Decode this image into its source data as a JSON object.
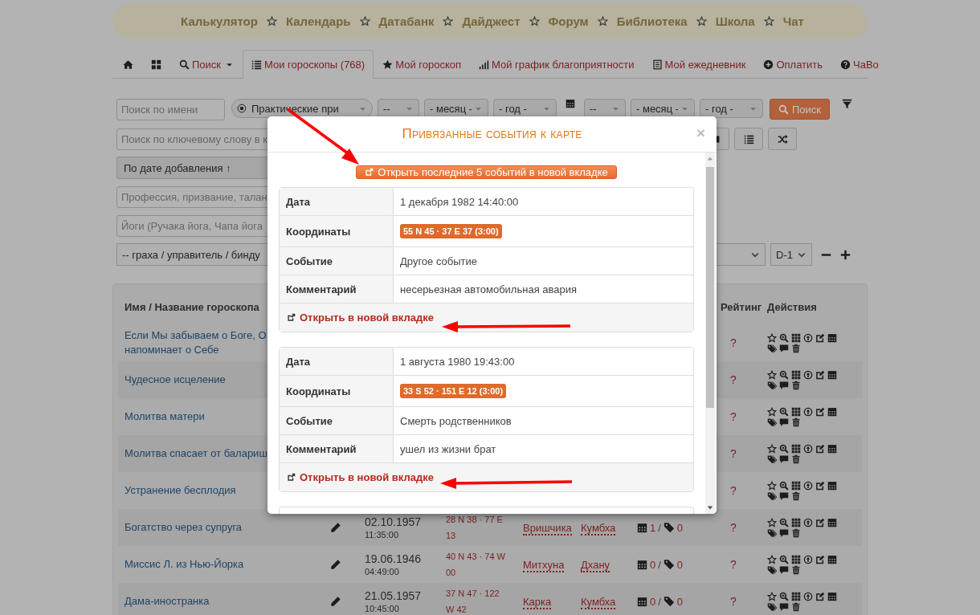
{
  "top_menu": [
    {
      "label": "Калькулятор"
    },
    {
      "label": "Календарь"
    },
    {
      "label": "Датабанк"
    },
    {
      "label": "Дайджест"
    },
    {
      "label": "Форум"
    },
    {
      "label": "Библиотека"
    },
    {
      "label": "Школа"
    },
    {
      "label": "Чат"
    }
  ],
  "tabs": [
    {
      "selected": false
    },
    {
      "selected": false
    },
    {
      "label": "Поиск",
      "selected": false,
      "dropdown": true
    },
    {
      "label": "Мои гороскопы (768)",
      "selected": true
    },
    {
      "label": "Мой гороскоп",
      "selected": false
    },
    {
      "label": "Мой график благоприятности",
      "selected": false
    },
    {
      "label": "Мой ежедневник",
      "selected": false
    },
    {
      "label": "Оплатить",
      "selected": false
    },
    {
      "label": "ЧаВо",
      "selected": false
    }
  ],
  "filters": {
    "name_search": {
      "placeholder": "Поиск по имени"
    },
    "category_select": {
      "value": "Практические при"
    },
    "date_from": [
      {
        "value": "--"
      },
      {
        "value": "- месяц -"
      },
      {
        "value": "- год -"
      }
    ],
    "date_to": [
      {
        "value": "--"
      },
      {
        "value": "- месяц -"
      },
      {
        "value": "- год -"
      }
    ],
    "search_button": "Поиск",
    "keyword_search": {
      "placeholder": "Поиск по ключевому слову в к"
    },
    "sort_select": {
      "value": "По дате добавления ↑"
    },
    "profession_search": {
      "placeholder": "Профессия, призвание, талан"
    },
    "yoga_search": {
      "placeholder": "Йоги (Ручака йога, Чапа йога"
    },
    "graha_select": {
      "value": "-- граха / управитель / бинду"
    },
    "chart_select": {
      "value": "D-1"
    }
  },
  "table": {
    "columns": {
      "name": "Имя / Название гороскопа",
      "rating": "Рейтинг",
      "actions": "Действия"
    },
    "rows": [
      {
        "name": "Если Мы забываем о Боге, О напоминает о Себе",
        "rating": "?"
      },
      {
        "name": "Чудесное исцеление",
        "rating": "?"
      },
      {
        "name": "Молитва матери",
        "rating": "?"
      },
      {
        "name": "Молитва спасает от балариш",
        "rating": "?"
      },
      {
        "name": "Устранение бесплодия",
        "rating": "?"
      },
      {
        "name": "Богатство через супруга",
        "date": "02.10.1957",
        "time": "11:35:00",
        "coords": "28 N 38 · 77 E 13",
        "column_6": "Вришчика",
        "column_7": "Кумбха",
        "events_count": "1",
        "count_separator": "/",
        "tags_count": "0",
        "rating": "?"
      },
      {
        "name": "Миссис Л. из Нью-Йорка",
        "date": "19.06.1946",
        "time": "04:49:00",
        "coords": "40 N 43 · 74 W 00",
        "column_6": "Митхуна",
        "column_7": "Дхану",
        "events_count": "0",
        "count_separator": "/",
        "tags_count": "0",
        "rating": "?"
      },
      {
        "name": "Дама-иностранка",
        "date": "21.05.1957",
        "time": "10:45:00",
        "coords": "37 N 47 · 122 W 42",
        "column_6": "Карка",
        "column_7": "Кумбха",
        "events_count": "0",
        "count_separator": "/",
        "tags_count": "0",
        "rating": "?"
      }
    ]
  },
  "modal": {
    "title": "Привязанные события к карте",
    "close": "×",
    "open_all_button": "Открыть последние 5 событий в новой вкладке",
    "events": [
      {
        "fields": [
          {
            "label": "Дата",
            "value": "1 декабря 1982 14:40:00",
            "kind": "text"
          },
          {
            "label": "Координаты",
            "value": "55 N 45 · 37 E 37 (3:00)",
            "kind": "badge"
          },
          {
            "label": "Событие",
            "value": "Другое событие",
            "kind": "text"
          },
          {
            "label": "Комментарий",
            "value": "несерьезная автомобильная авария",
            "kind": "text"
          }
        ],
        "link": "Открыть в новой вкладке"
      },
      {
        "fields": [
          {
            "label": "Дата",
            "value": "1 августа 1980 19:43:00",
            "kind": "text"
          },
          {
            "label": "Координаты",
            "value": "33 S 52 · 151 E 12 (3:00)",
            "kind": "badge"
          },
          {
            "label": "Событие",
            "value": "Смерть родственников",
            "kind": "text"
          },
          {
            "label": "Комментарий",
            "value": "ушел из жизни брат",
            "kind": "text"
          }
        ],
        "link": "Открыть в новой вкладке"
      }
    ]
  }
}
